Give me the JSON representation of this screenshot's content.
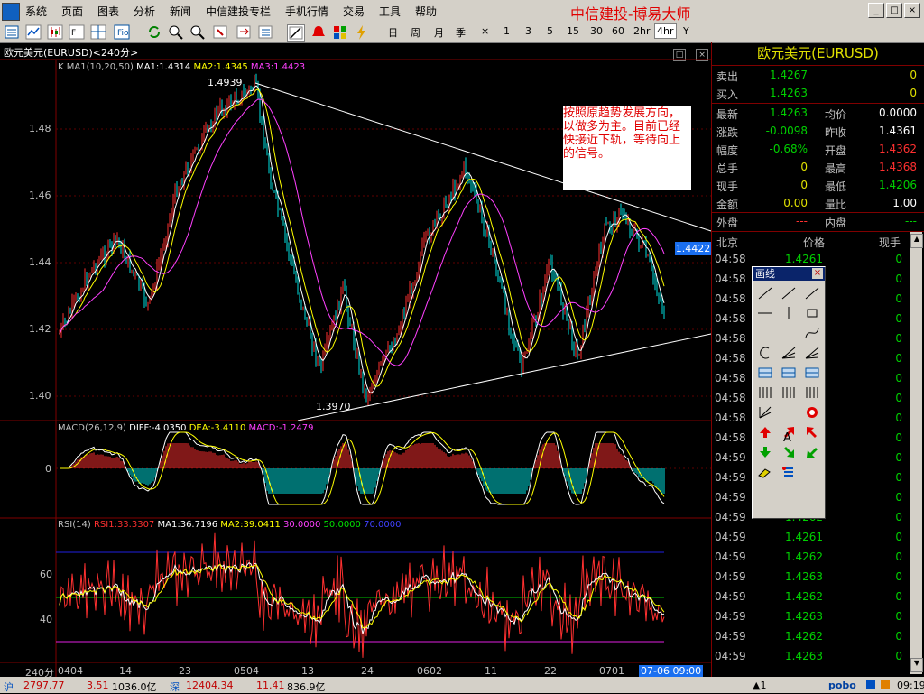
{
  "menu": [
    "系统",
    "页面",
    "图表",
    "分析",
    "新闻",
    "中信建投专栏",
    "手机行情",
    "交易",
    "工具",
    "帮助"
  ],
  "brand": "中信建投-博易大师",
  "window_controls": [
    "_",
    "□",
    "×"
  ],
  "periods": [
    "日",
    "周",
    "月",
    "季",
    "×",
    "1",
    "3",
    "5",
    "15",
    "30",
    "60",
    "2hr",
    "4hr",
    "Y"
  ],
  "active_period": "4hr",
  "chart": {
    "title": "欧元美元(EURUSD)<240分>",
    "ma_prefix": "K  MA1(10,20,50)",
    "ma1": "MA1:1.4314",
    "ma2": "MA2:1.4345",
    "ma3": "MA3:1.4423",
    "high_label": "1.4939",
    "low_label": "1.3970",
    "current_price": "1.4422",
    "y_ticks": [
      "1.48",
      "1.46",
      "1.44",
      "1.42",
      "1.40"
    ],
    "macd_prefix": "MACD(26,12,9)",
    "diff": "DIFF:-4.0350",
    "dea": "DEA:-3.4110",
    "macd": "MACD:-1.2479",
    "macd_zero": "0",
    "rsi_prefix": "RSI(14)",
    "rsi1": "RSI1:33.3307",
    "rsi_ma1": "MA1:36.7196",
    "rsi_ma2": "MA2:39.0411",
    "rsi_l30": "30.0000",
    "rsi_l50": "50.0000",
    "rsi_l70": "70.0000",
    "rsi_ticks": [
      "60",
      "40"
    ],
    "period_label": "240分",
    "x_labels": [
      "0404",
      "14",
      "23",
      "0504",
      "13",
      "24",
      "0602",
      "11",
      "22",
      "0701"
    ],
    "cursor_time": "07-06 09:00"
  },
  "annotation": "按照原趋势发展方向，以做多为主。目前已经快接近下轨，等待向上的信号。",
  "quote": {
    "title": "欧元美元(EURUSD)",
    "sell_label": "卖出",
    "sell": "1.4267",
    "sell_vol": "0",
    "buy_label": "买入",
    "buy": "1.4263",
    "buy_vol": "0",
    "rows": [
      {
        "k1": "最新",
        "v1": "1.4263",
        "k2": "均价",
        "v2": "0.0000"
      },
      {
        "k1": "涨跌",
        "v1": "-0.0098",
        "k2": "昨收",
        "v2": "1.4361"
      },
      {
        "k1": "幅度",
        "v1": "-0.68%",
        "k2": "开盘",
        "v2": "1.4362"
      },
      {
        "k1": "总手",
        "v1": "0",
        "k2": "最高",
        "v2": "1.4368"
      },
      {
        "k1": "现手",
        "v1": "0",
        "k2": "最低",
        "v2": "1.4206"
      },
      {
        "k1": "金额",
        "v1": "0.00",
        "k2": "量比",
        "v2": "1.00"
      }
    ],
    "outer_label": "外盘",
    "outer": "---",
    "inner_label": "内盘",
    "inner": "---",
    "tick_headers": [
      "北京",
      "价格",
      "现手"
    ],
    "ticks": [
      {
        "t": "04:58",
        "p": "1.4261",
        "v": "0"
      },
      {
        "t": "04:58",
        "p": "",
        "v": "0"
      },
      {
        "t": "04:58",
        "p": "",
        "v": "0"
      },
      {
        "t": "04:58",
        "p": "",
        "v": "0"
      },
      {
        "t": "04:58",
        "p": "",
        "v": "0"
      },
      {
        "t": "04:58",
        "p": "",
        "v": "0"
      },
      {
        "t": "04:58",
        "p": "",
        "v": "0"
      },
      {
        "t": "04:58",
        "p": "",
        "v": "0"
      },
      {
        "t": "04:58",
        "p": "",
        "v": "0"
      },
      {
        "t": "04:58",
        "p": "",
        "v": "0"
      },
      {
        "t": "04:59",
        "p": "",
        "v": "0"
      },
      {
        "t": "04:59",
        "p": "",
        "v": "0"
      },
      {
        "t": "04:59",
        "p": "",
        "v": "0"
      },
      {
        "t": "04:59",
        "p": "1.4262",
        "v": "0"
      },
      {
        "t": "04:59",
        "p": "1.4261",
        "v": "0"
      },
      {
        "t": "04:59",
        "p": "1.4262",
        "v": "0"
      },
      {
        "t": "04:59",
        "p": "1.4263",
        "v": "0"
      },
      {
        "t": "04:59",
        "p": "1.4262",
        "v": "0"
      },
      {
        "t": "04:59",
        "p": "1.4263",
        "v": "0"
      },
      {
        "t": "04:59",
        "p": "1.4262",
        "v": "0"
      },
      {
        "t": "04:59",
        "p": "1.4263",
        "v": "0"
      }
    ]
  },
  "draw_panel": {
    "title": "画线",
    "close": "×",
    "text_tool": "A"
  },
  "status": {
    "sh_label": "沪",
    "sh_index": "2797.77",
    "sh_change": "3.51",
    "sh_amount": "1036.0亿",
    "sz_label": "深",
    "sz_index": "12404.34",
    "sz_change": "11.41",
    "sz_amount": "836.9亿",
    "alert": "▲1",
    "logo": "pobo",
    "time": "09:19"
  },
  "colors": {
    "up": "#ff3030",
    "down": "#00e0e0",
    "ma1": "#ffffff",
    "ma2": "#ffff00",
    "ma3": "#ff40ff",
    "accent": "#e0e000"
  }
}
